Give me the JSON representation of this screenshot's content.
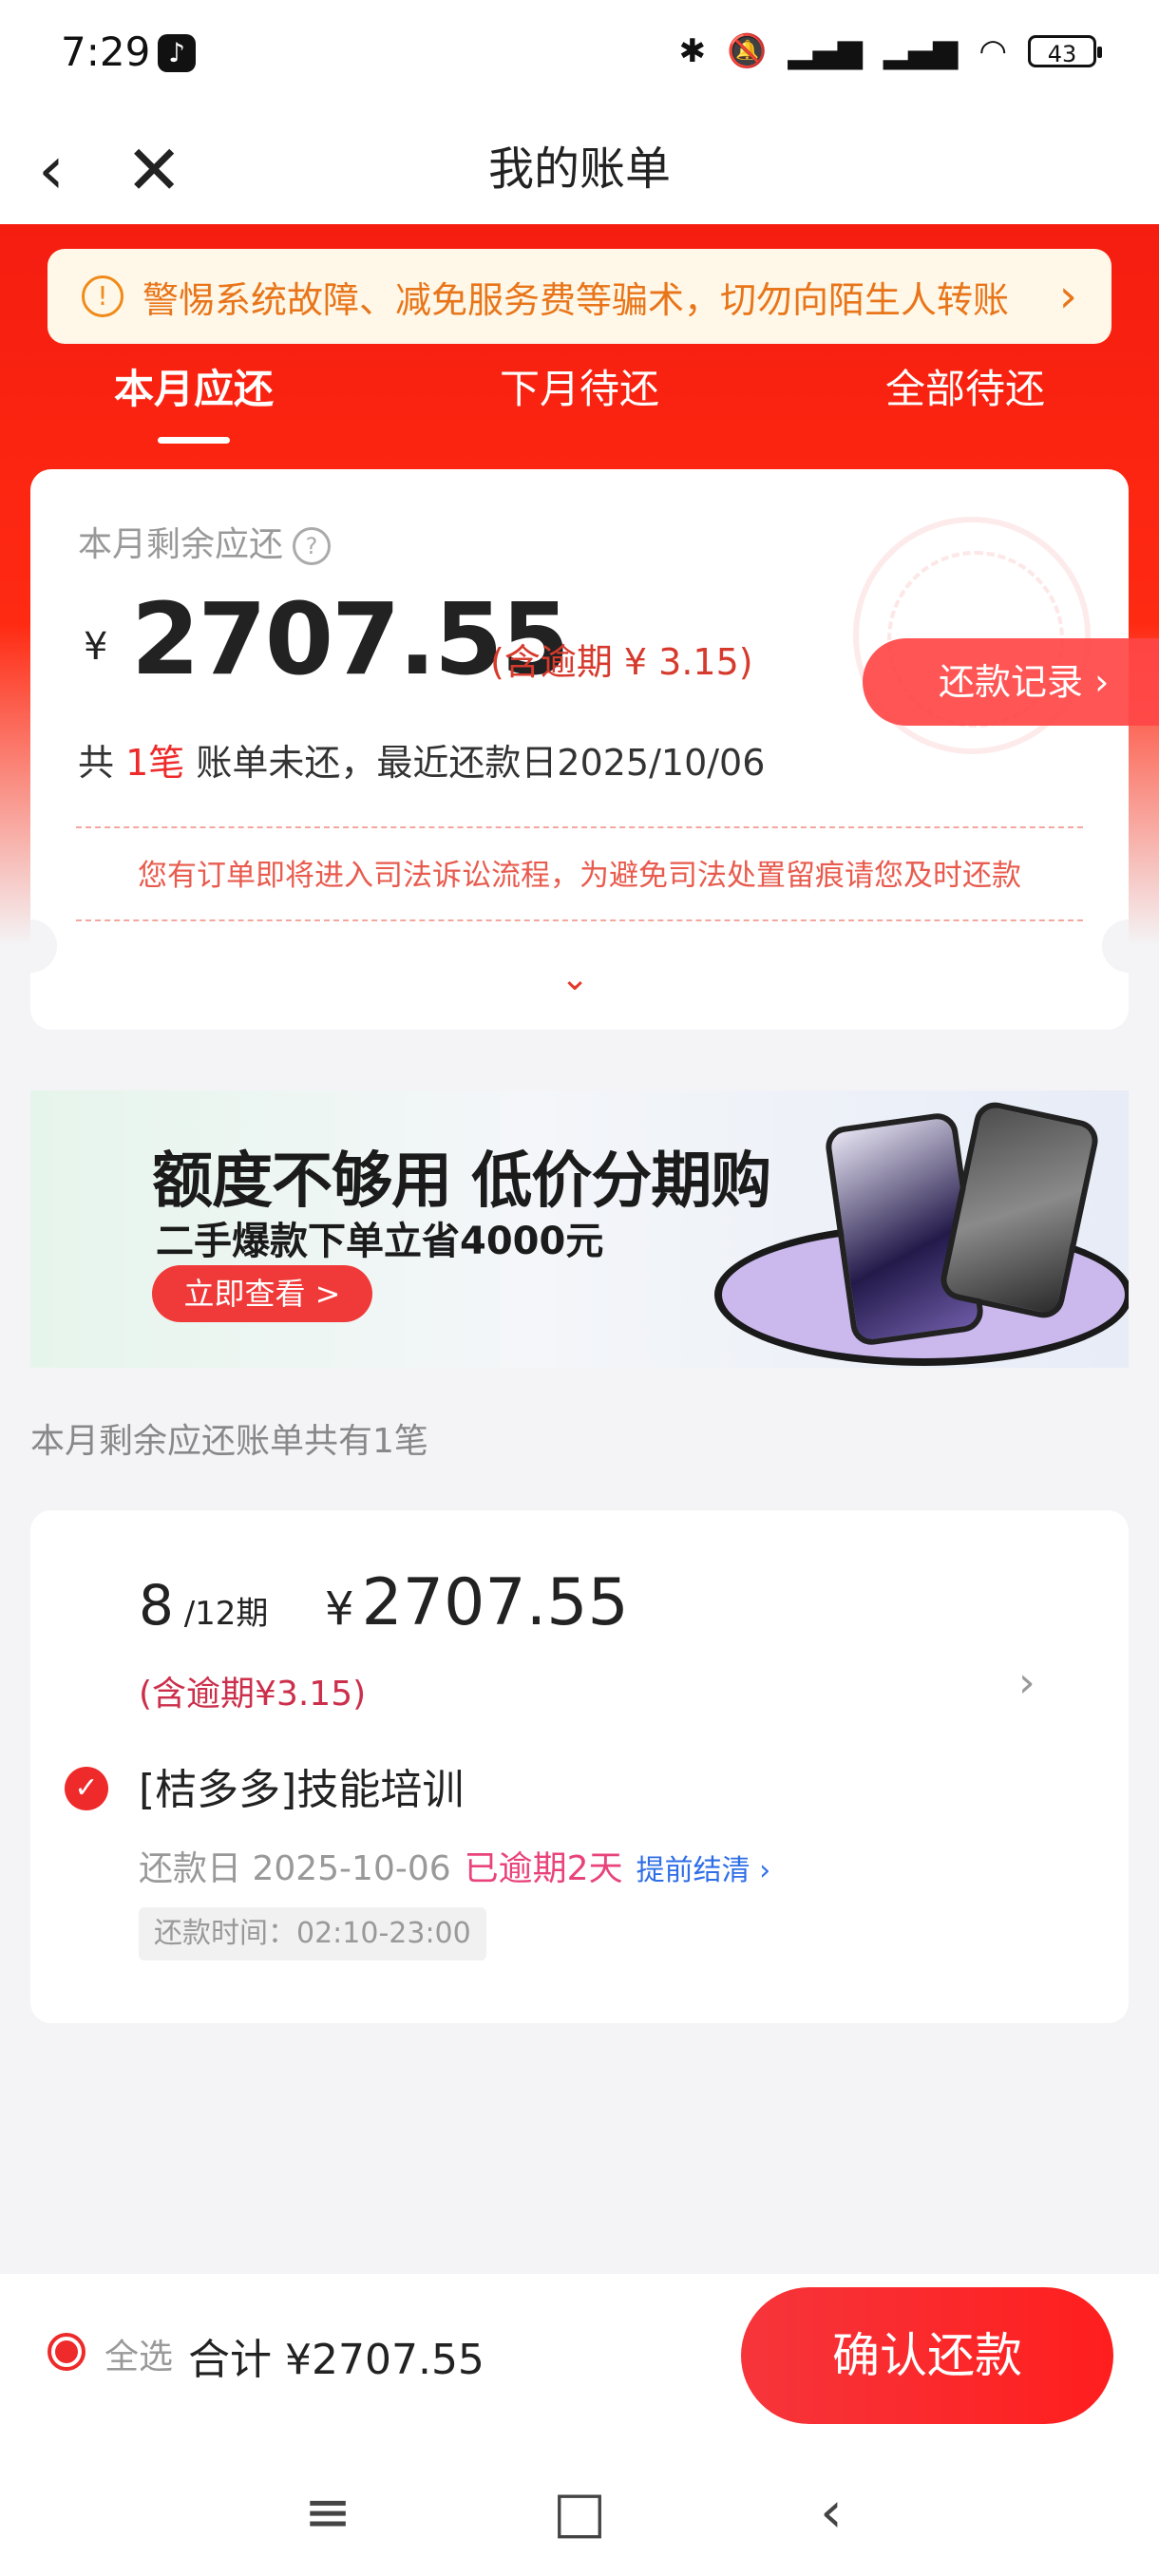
{
  "status": {
    "time": "7:29",
    "battery": "43"
  },
  "nav": {
    "back": "‹",
    "close": "✕",
    "title": "我的账单"
  },
  "notice": {
    "icon": "!",
    "text": "警惕系统故障、减免服务费等骗术，切勿向陌生人转账",
    "arrow": "›"
  },
  "tabs": [
    {
      "label": "本月应还"
    },
    {
      "label": "下月待还"
    },
    {
      "label": "全部待还"
    }
  ],
  "summary": {
    "label": "本月剩余应还",
    "help_icon": "?",
    "yen": "¥",
    "amount": "2707.55",
    "overdue_note": "(含逾期 ¥ 3.15)",
    "count_prefix": "共",
    "count_value": "1笔",
    "count_suffix": "账单未还，最近还款日2025/10/06",
    "warning": "您有订单即将进入司法诉讼流程，为避免司法处置留痕请您及时还款",
    "record_button": "还款记录 ›",
    "expand_icon": "⌄"
  },
  "banner": {
    "title": "额度不够用 低价分期购",
    "subtitle": "二手爆款下单立省4000元",
    "button": "立即查看 >"
  },
  "section_label": "本月剩余应还账单共有1笔",
  "bill": {
    "period_current": "8",
    "period_total": " /12期",
    "yen": "¥",
    "amount": "2707.55",
    "overdue": "(含逾期¥3.15)",
    "chevron": "›",
    "check": "✓",
    "name": "[桔多多]技能培训",
    "due_label": "还款日 2025-10-06",
    "overdue_days": "已逾期2天",
    "early_payoff": "提前结清 ›",
    "repay_time": "还款时间：02:10-23:00"
  },
  "bottom": {
    "select_all": "全选",
    "total": "合计 ¥2707.55",
    "confirm": "确认还款"
  },
  "system_nav": {
    "menu": "≡",
    "home": "□",
    "back": "‹"
  },
  "colors": {
    "primary_red": "#f51d10",
    "notice_bg": "#fff8e8",
    "notice_text": "#e8751a"
  }
}
